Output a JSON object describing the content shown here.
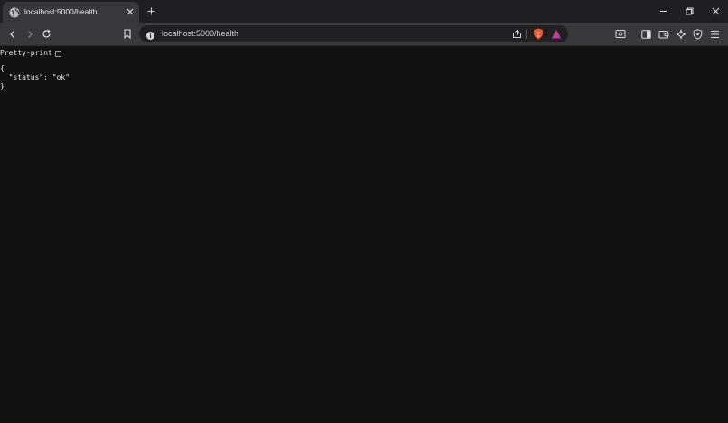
{
  "tab": {
    "title": "localhost:5000/health",
    "favicon": "globe-icon"
  },
  "window_controls": [
    "minimize-icon",
    "restore-icon",
    "close-icon"
  ],
  "toolbar": {
    "url": "localhost:5000/health",
    "icons": [
      "back-icon",
      "forward-icon",
      "reload-icon",
      "bookmark-icon",
      "info-icon",
      "share-icon",
      "brave-shields-icon",
      "brave-rewards-icon",
      "screenshot-icon",
      "sidebar-icon",
      "wallet-icon",
      "leo-ai-icon",
      "vpn-icon",
      "menu-icon"
    ]
  },
  "page": {
    "pretty_print_label": "Pretty-print",
    "json_open": "{",
    "json_line": "  \"status\": \"ok\"",
    "json_close": "}"
  },
  "colors": {
    "background": "#121212",
    "tab_active": "#38383b",
    "toolbar": "#38383b",
    "brave_orange": "#fb542b"
  }
}
